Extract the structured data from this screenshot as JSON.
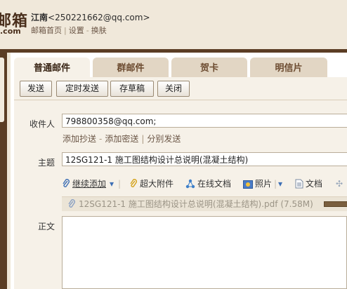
{
  "header": {
    "logo_text": "邮箱",
    "logo_sub": ".com",
    "user_name": "江南",
    "user_email": "<250221662@qq.com>",
    "nav": [
      "邮箱首页",
      "设置",
      "换肤"
    ]
  },
  "tabs": [
    "普通邮件",
    "群邮件",
    "贺卡",
    "明信片"
  ],
  "actions": [
    "发送",
    "定时发送",
    "存草稿",
    "关闭"
  ],
  "form": {
    "to_label": "收件人",
    "to_value": "798800358@qq.com;",
    "to_links": [
      "添加抄送",
      "添加密送",
      "分别发送"
    ],
    "subject_label": "主题",
    "subject_value": "12SG121-1 施工图结构设计总说明(混凝土结构)",
    "body_label": "正文"
  },
  "toolbar": {
    "continue_add": "继续添加",
    "big_attach": "超大附件",
    "online_doc": "在线文档",
    "photo": "照片",
    "doc": "文档"
  },
  "attachment": {
    "filename": "12SG121-1 施工图结构设计总说明(混凝土结构).pdf (7.58M)",
    "progress": 0.1
  },
  "colors": {
    "frame": "#5b3d24",
    "panel": "#f6f1e8",
    "tab_inactive": "#e2d6c4"
  }
}
